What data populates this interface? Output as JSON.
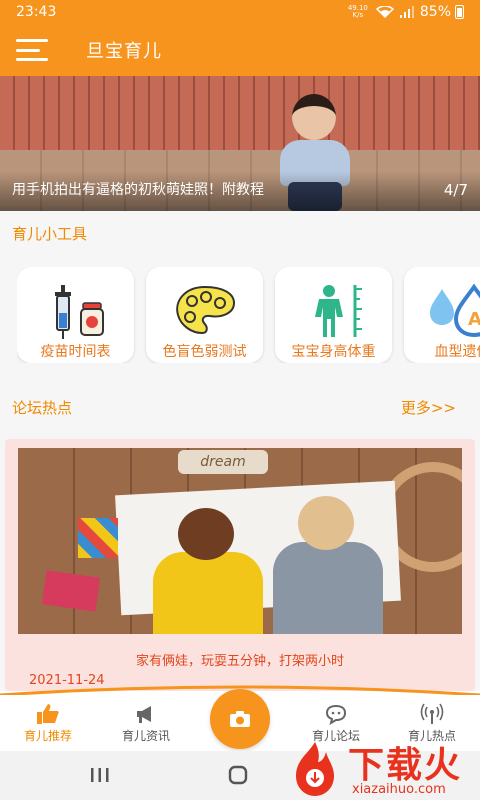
{
  "status_bar": {
    "time": "23:43",
    "net_speed_value": "49.10",
    "net_speed_unit": "K/s",
    "battery": "85%"
  },
  "app_bar": {
    "title": "旦宝育儿"
  },
  "banner": {
    "caption": "用手机拍出有逼格的初秋萌娃照！附教程",
    "index": "4/7"
  },
  "tools": {
    "title": "育儿小工具",
    "items": [
      {
        "label": "疫苗时间表",
        "icon": "vaccine-icon"
      },
      {
        "label": "色盲色弱测试",
        "icon": "palette-icon"
      },
      {
        "label": "宝宝身高体重",
        "icon": "height-icon"
      },
      {
        "label": "血型遗传",
        "icon": "blood-type-icon"
      }
    ]
  },
  "forum": {
    "title": "论坛热点",
    "more": "更多>>",
    "post": {
      "image_text": "dream",
      "title": "家有俩娃，玩耍五分钟，打架两小时",
      "date": "2021-11-24"
    }
  },
  "tabs": [
    {
      "label": "育儿推荐",
      "icon": "thumbs-up-icon",
      "active": true
    },
    {
      "label": "育儿资讯",
      "icon": "megaphone-icon",
      "active": false
    },
    {
      "label": "",
      "icon": "camera-icon",
      "active": false
    },
    {
      "label": "育儿论坛",
      "icon": "forum-icon",
      "active": false
    },
    {
      "label": "育儿热点",
      "icon": "broadcast-icon",
      "active": false
    }
  ],
  "watermark": {
    "brand": "下载火",
    "url": "xiazaihuo.com"
  },
  "colors": {
    "primary": "#f7941d",
    "accent_text": "#f08a00",
    "post_text": "#e3461e",
    "post_bg": "#fbe2de"
  }
}
